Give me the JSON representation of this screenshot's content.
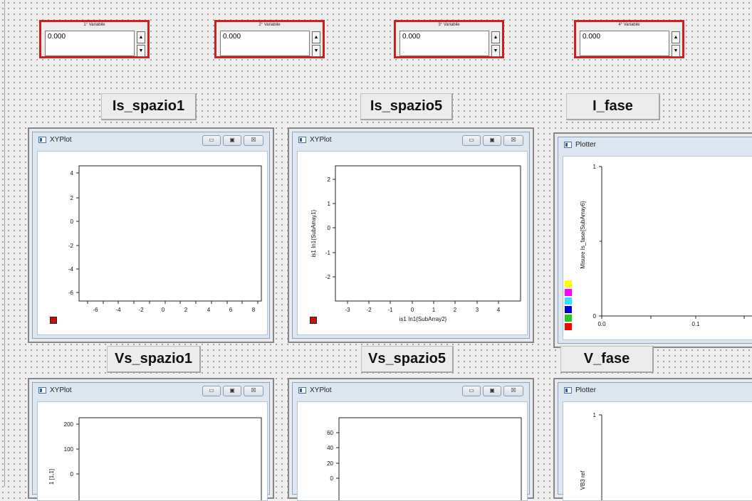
{
  "variables": [
    {
      "title": "1° Variabile",
      "value": "0.000"
    },
    {
      "title": "2° Variabile",
      "value": "0.000"
    },
    {
      "title": "3° Variabile",
      "value": "0.000"
    },
    {
      "title": "4° Variabile",
      "value": "0.000"
    }
  ],
  "spin_up_glyph": "▲",
  "spin_down_glyph": "▼",
  "labels": {
    "is_spazio1": "Is_spazio1",
    "is_spazio5": "Is_spazio5",
    "i_fase": "I_fase",
    "vs_spazio1": "Vs_spazio1",
    "vs_spazio5": "Vs_spazio5",
    "v_fase": "V_fase"
  },
  "window_buttons": {
    "minimize": "▭",
    "maximize": "▣",
    "close": "☒"
  },
  "plots": {
    "xy1": {
      "title": "XYPlot",
      "y_ticks": [
        "4",
        "2",
        "0",
        "-2",
        "-4",
        "-6"
      ],
      "x_ticks": [
        "-6",
        "-4",
        "-2",
        "0",
        "2",
        "4",
        "6",
        "8"
      ]
    },
    "xy2": {
      "title": "XYPlot",
      "y_ticks": [
        "2",
        "1",
        "0",
        "-1",
        "-2"
      ],
      "x_ticks": [
        "-3",
        "-2",
        "-1",
        "0",
        "1",
        "2",
        "3",
        "4"
      ],
      "xlabel": "is1 In1{SubArray2}",
      "ylabel": "is1 In1{SubArray1}"
    },
    "plotter1": {
      "title": "Plotter",
      "y_ticks": [
        "1",
        "0"
      ],
      "x_ticks": [
        "0.0",
        "0.1"
      ],
      "ylabel": "Misure Is_fase{SubArray6}",
      "legend_colors": [
        "#ffff00",
        "#ff00ff",
        "#33e0ff",
        "#0000d0",
        "#22cc22",
        "#ff0000"
      ]
    },
    "xy3": {
      "title": "XYPlot",
      "y_ticks": [
        "200",
        "100",
        "0"
      ],
      "ylabel": "1 [1,1]"
    },
    "xy4": {
      "title": "XYPlot",
      "y_ticks": [
        "60",
        "40",
        "20",
        "0"
      ]
    },
    "plotter2": {
      "title": "Plotter",
      "y_ticks": [
        "1"
      ],
      "ylabel": "VB3 ref"
    }
  }
}
